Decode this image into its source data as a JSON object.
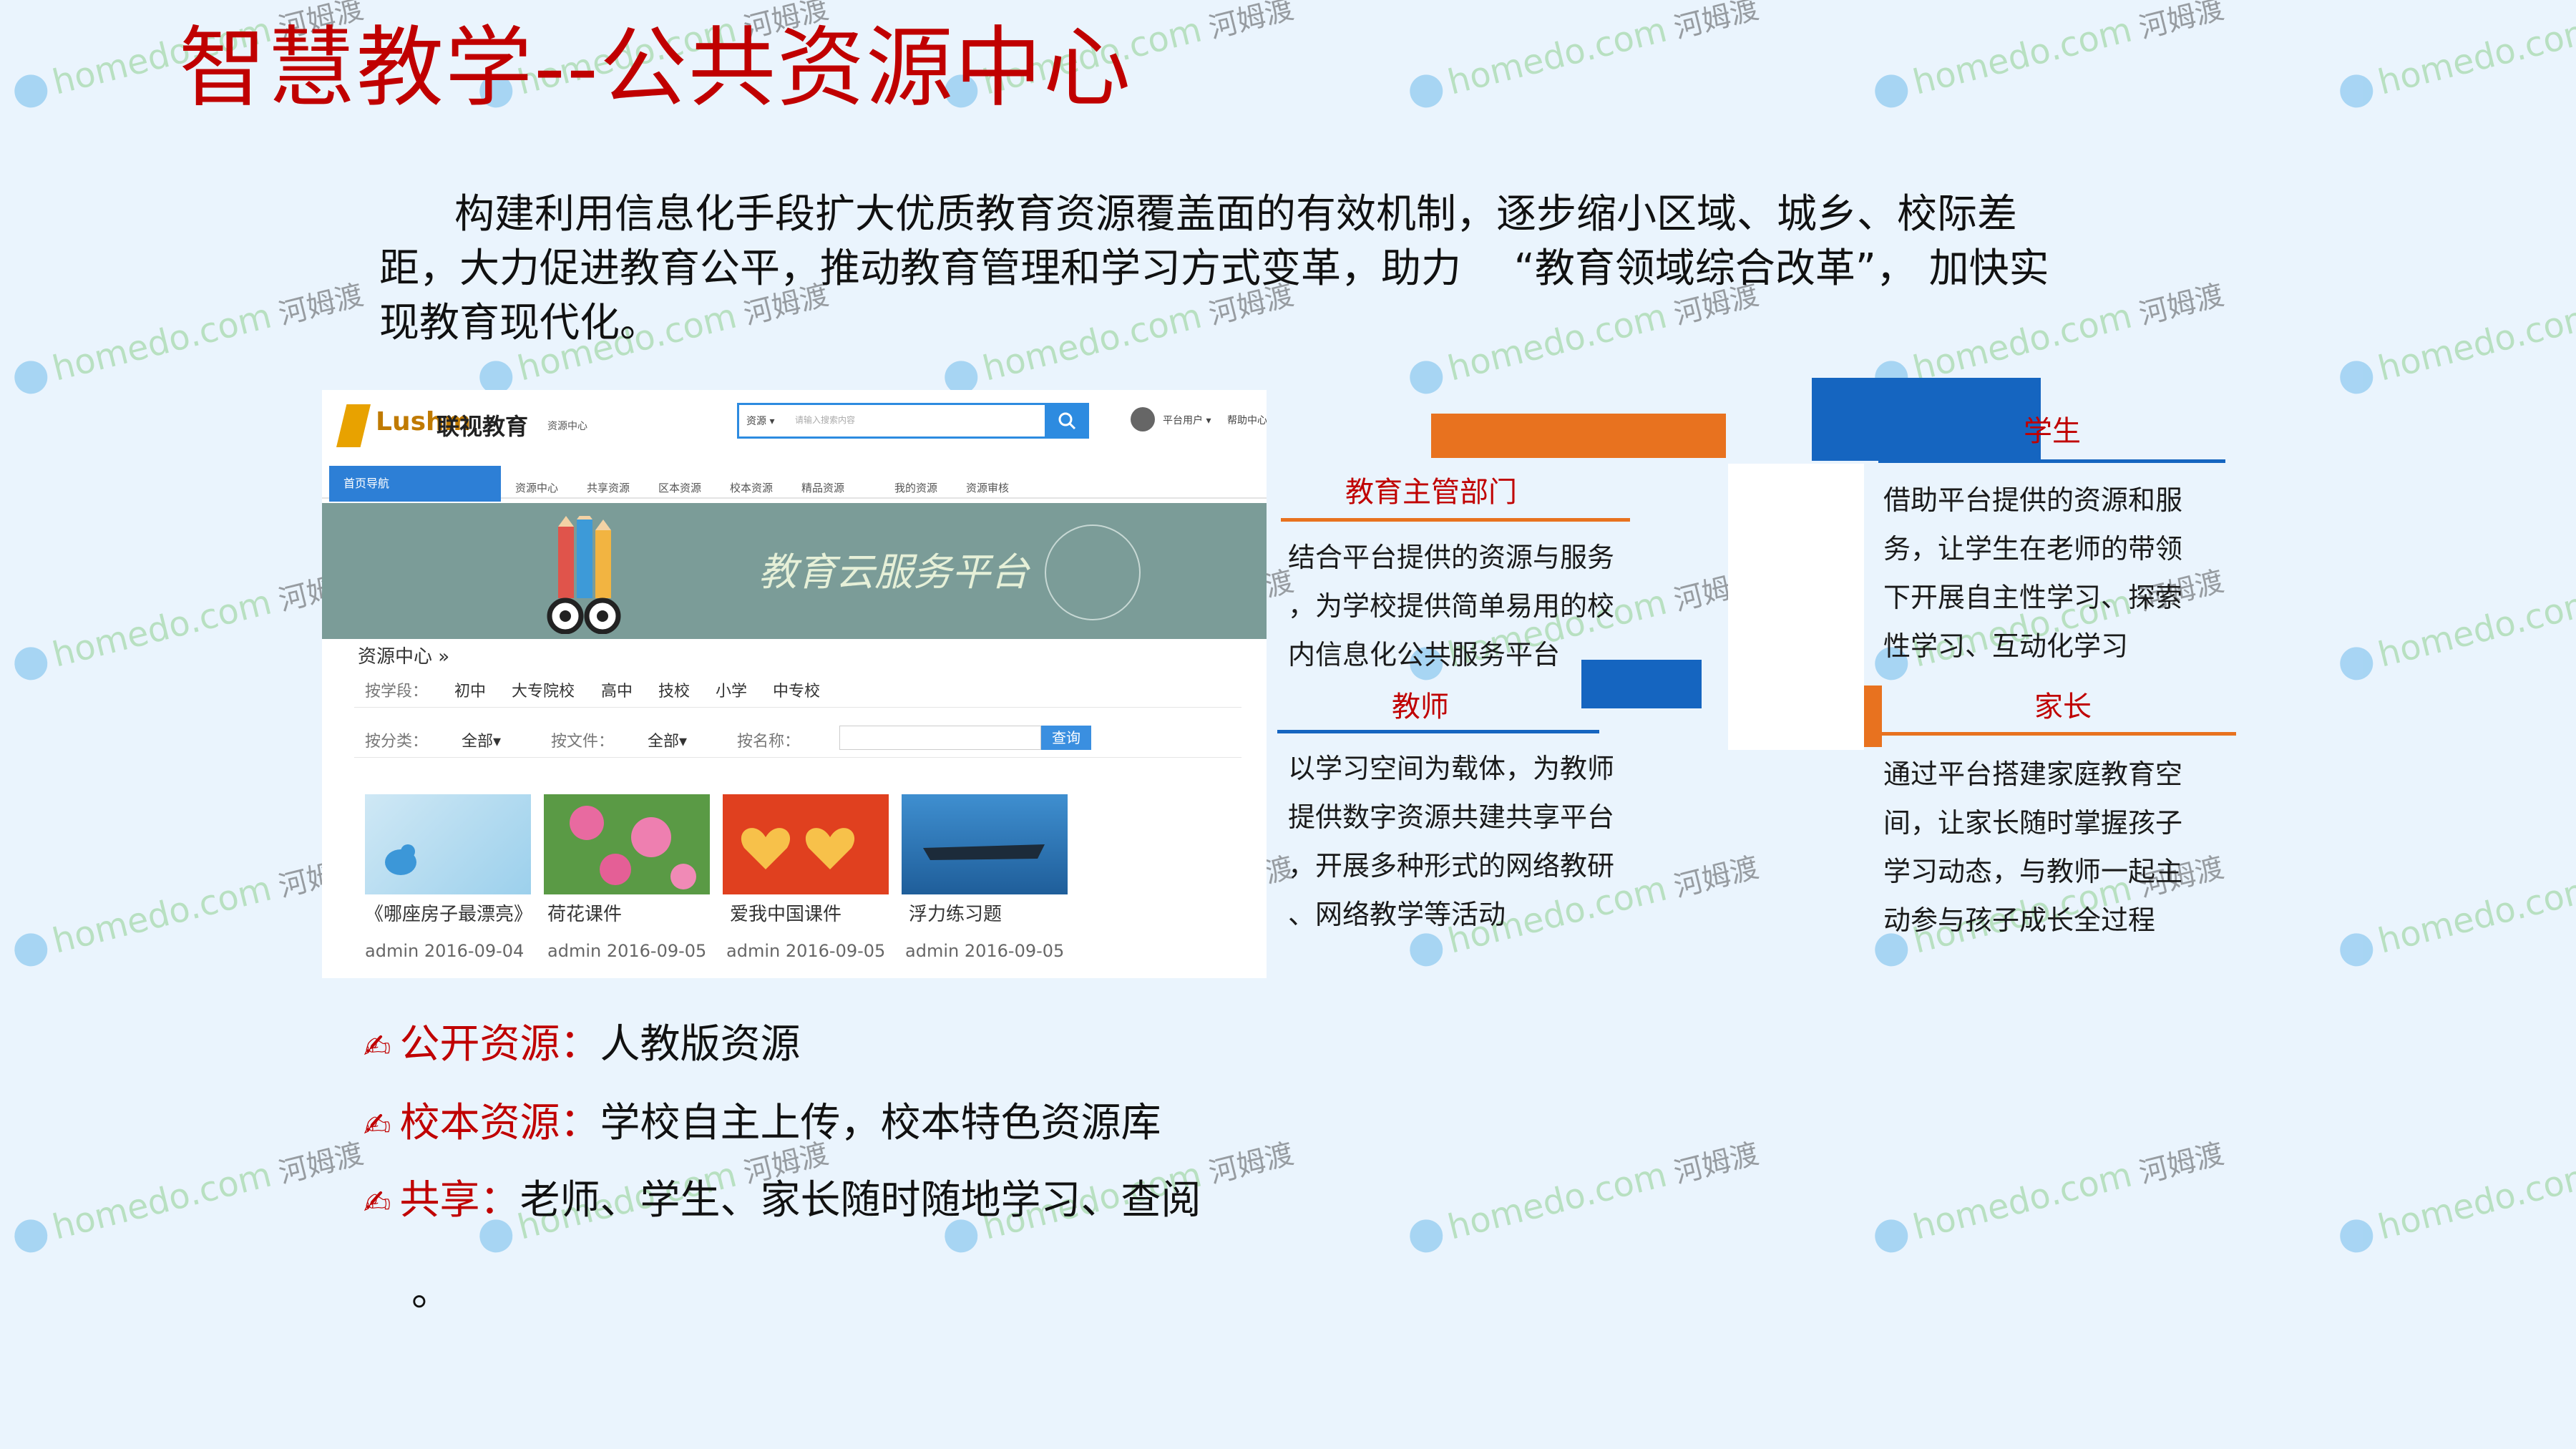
{
  "title": "智慧教学--公共资源中心",
  "intro": {
    "line1": "构建利用信息化手段扩大优质教育资源覆盖面的有效机制，逐步缩小区域、城乡、校际差",
    "line2": "距，大力促进教育公平，推动教育管理和学习方式变革，助力　 “教育领域综合改革”， 加快实",
    "line3": "现教育现代化。"
  },
  "screenshot": {
    "logo_latin": "Lushm",
    "logo_cn": "联视教育",
    "logo_sub": "资源中心",
    "search_scope": "资源 ▾",
    "search_placeholder": "请输入搜索内容",
    "user_name": "平台用户 ▾",
    "help": "帮助中心",
    "nav_home": "首页导航",
    "nav_items": [
      "资源中心",
      "共享资源",
      "区本资源",
      "校本资源",
      "精品资源",
      "我的资源",
      "资源审核"
    ],
    "banner_text": "教育云服务平台",
    "resource_center": "资源中心 »",
    "filter1_label": "按学段：",
    "filter1_values": [
      "初中",
      "大专院校",
      "高中",
      "技校",
      "小学",
      "中专校"
    ],
    "filter2_label1": "按分类：",
    "filter2_value1": "全部▾",
    "filter2_label2": "按文件：",
    "filter2_value2": "全部▾",
    "filter2_label3": "按名称：",
    "query_button": "查询",
    "items": [
      {
        "caption": "《哪座房子最漂亮》",
        "meta": "admin 2016-09-04"
      },
      {
        "caption": "荷花课件",
        "meta": "admin 2016-09-05"
      },
      {
        "caption": "爱我中国课件",
        "meta": "admin 2016-09-05"
      },
      {
        "caption": "浮力练习题",
        "meta": "admin 2016-09-05"
      }
    ]
  },
  "roles": {
    "dept": {
      "title": "教育主管部门",
      "lines": [
        "结合平台提供的资源与服务",
        "，为学校提供简单易用的校",
        "内信息化公共服务平台"
      ]
    },
    "teacher": {
      "title": "教师",
      "lines": [
        "以学习空间为载体，为教师",
        "提供数字资源共建共享平台",
        "，开展多种形式的网络教研",
        "、网络教学等活动"
      ]
    },
    "student": {
      "title": "学生",
      "lines": [
        "借助平台提供的资源和服",
        "务，让学生在老师的带领",
        "下开展自主性学习、探索",
        "性学习、互动化学习"
      ]
    },
    "parent": {
      "title": "家长",
      "lines": [
        "通过平台搭建家庭教育空",
        "间，让家长随时掌握孩子",
        "学习动态，与教师一起主",
        "动参与孩子成长全过程"
      ]
    }
  },
  "bullets": [
    {
      "key": "公开资源：",
      "value": "人教版资源"
    },
    {
      "key": "校本资源：",
      "value": "学校自主上传，校本特色资源库"
    },
    {
      "key": "共享：",
      "value": "老师、学生、家长随时随地学习、查阅"
    }
  ],
  "bullet_tail": "。",
  "watermark": {
    "text": "homedo.com",
    "cn": "河姆渡"
  },
  "colors": {
    "title_red": "#c00000",
    "orange": "#e8721f",
    "blue": "#1565c0",
    "background": "#eaf4fd"
  }
}
